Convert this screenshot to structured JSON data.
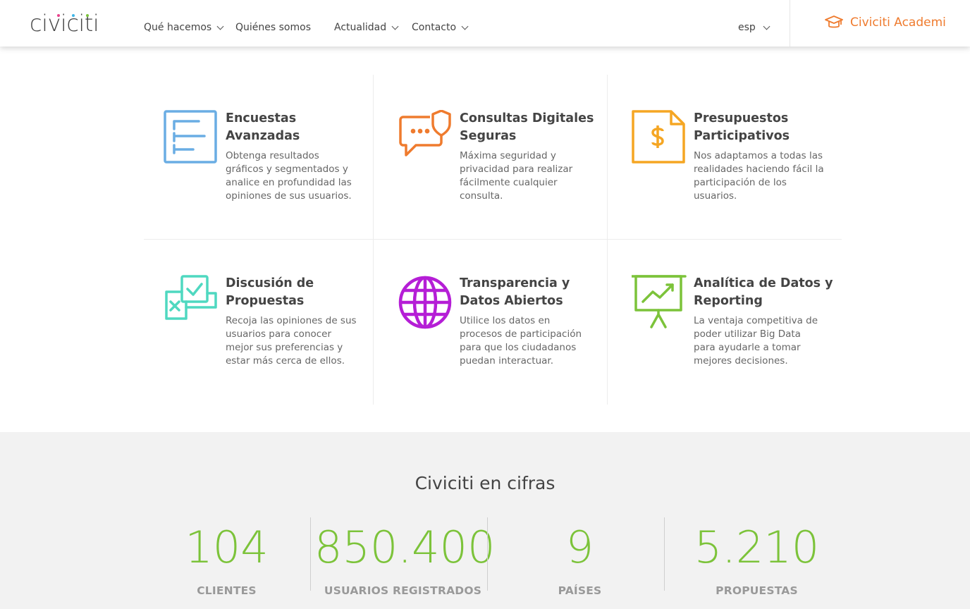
{
  "header": {
    "logo_text": "civiciti",
    "nav": [
      {
        "label": "Qué hacemos",
        "has_dropdown": true
      },
      {
        "label": "Quiénes somos",
        "has_dropdown": false
      },
      {
        "label": "Actualidad",
        "has_dropdown": true
      },
      {
        "label": "Contacto",
        "has_dropdown": true
      }
    ],
    "language": "esp",
    "academy_label": "Civiciti Academi",
    "academy_color": "#ef7b2e"
  },
  "features": [
    {
      "icon": "list-icon",
      "color": "#6aade4",
      "title": "Encuestas Avanzadas",
      "description": "Obtenga resultados gráficos y segmentados y analice en profundidad las opiniones de sus usuarios."
    },
    {
      "icon": "chat-shield-icon",
      "color": "#ef7b2e",
      "title": "Consultas Digitales Seguras",
      "description": "Máxima seguridad y privacidad para realizar fácilmente cualquier consulta."
    },
    {
      "icon": "dollar-document-icon",
      "color": "#f5a623",
      "title": "Presupuestos Participativos",
      "description": "Nos adaptamos a todas las realidades haciendo fácil la participación de los usuarios."
    },
    {
      "icon": "check-cross-cards-icon",
      "color": "#4fd8c0",
      "title": "Discusión de Propuestas",
      "description": "Recoja las opiniones de sus usuarios para conocer mejor sus preferencias y estar más cerca de ellos."
    },
    {
      "icon": "globe-icon",
      "color": "#b51ed6",
      "title": "Transparencia y Datos Abiertos",
      "description": "Utilice los datos en procesos de participación para que los ciudadanos puedan interactuar."
    },
    {
      "icon": "presentation-chart-icon",
      "color": "#7cc33a",
      "title": "Analítica de Datos y Reporting",
      "description": "La ventaja competitiva de poder utilizar Big Data para ayudarle a tomar mejores decisiones."
    }
  ],
  "stats": {
    "title": "Civiciti en cifras",
    "number_color": "#7cc33a",
    "items": [
      {
        "value": "104",
        "label": "CLIENTES"
      },
      {
        "value": "850.400",
        "label": "USUARIOS REGISTRADOS"
      },
      {
        "value": "9",
        "label": "PAÍSES"
      },
      {
        "value": "5.210",
        "label": "PROPUESTAS"
      }
    ]
  }
}
